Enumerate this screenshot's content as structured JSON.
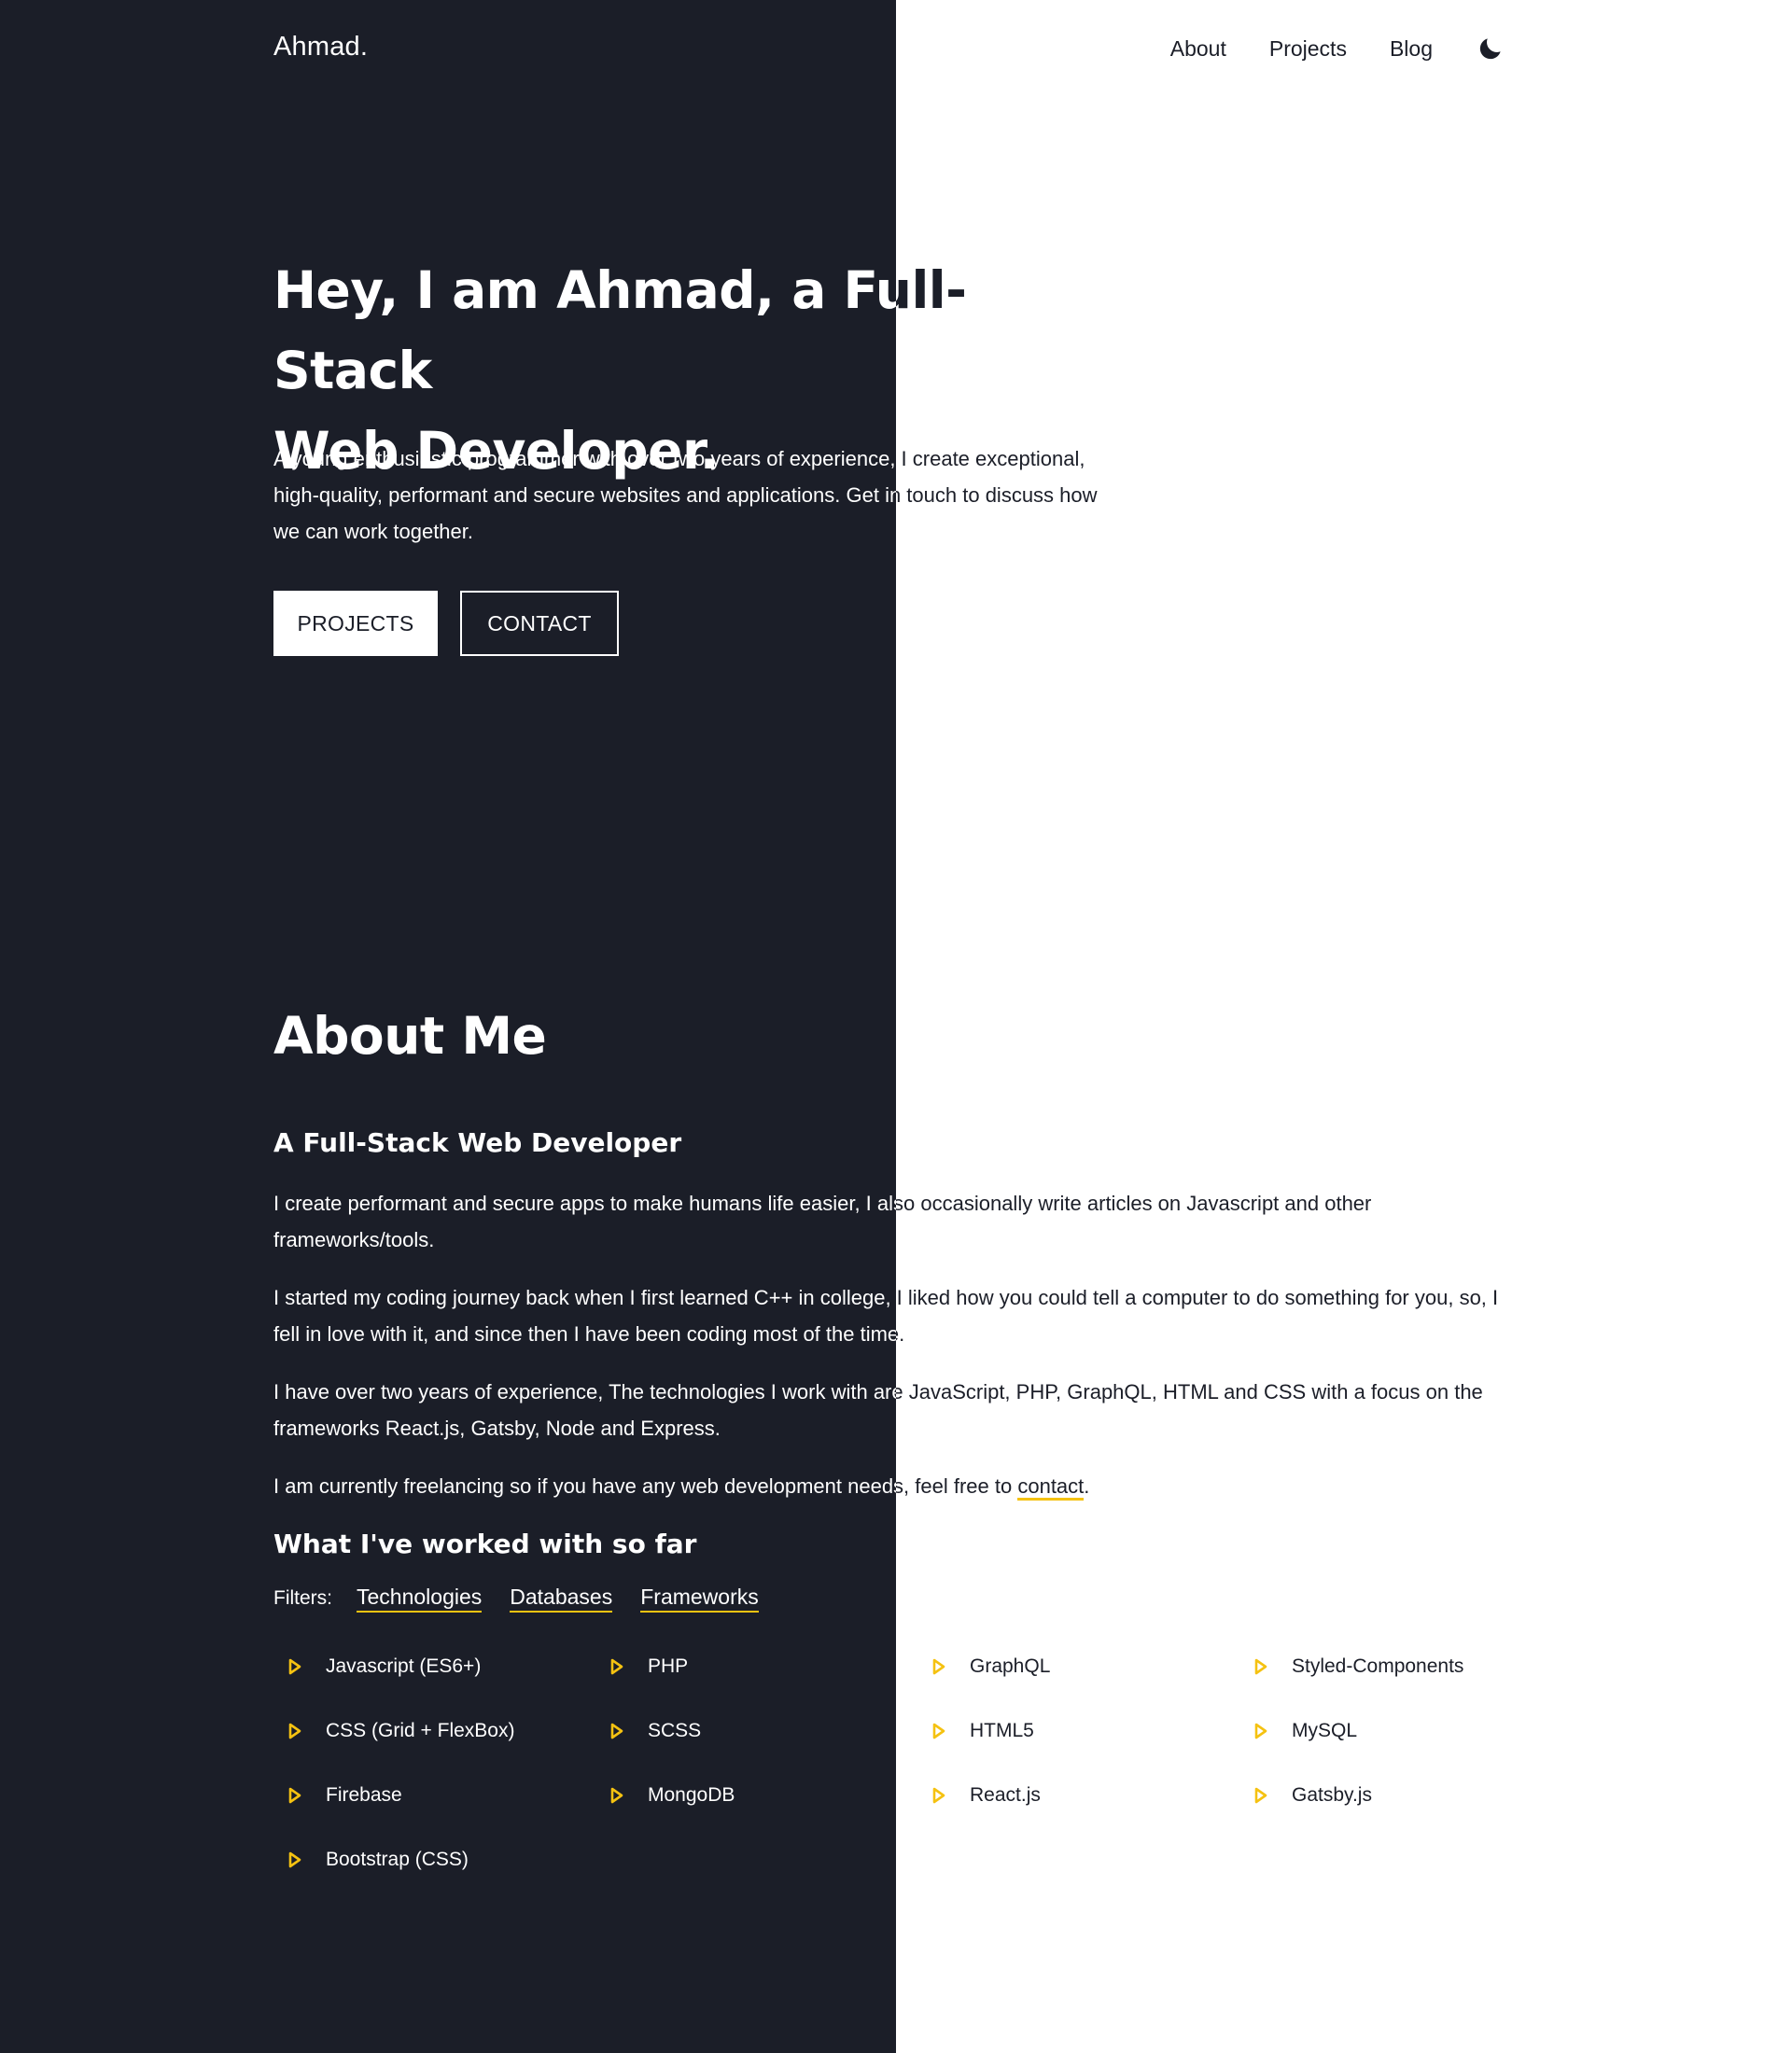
{
  "colors": {
    "dark": "#1b1e28",
    "light": "#ffffff",
    "accent": "#f5c211"
  },
  "header": {
    "logo": "Ahmad.",
    "nav": [
      "About",
      "Projects",
      "Blog"
    ],
    "theme_toggle_icon": "moon-icon"
  },
  "hero": {
    "title_line1": "Hey, I am Ahmad, a Full-Stack",
    "title_line2": "Web Developer.",
    "intro": "A young enthusiastic programmer with over two years of experience, I create exceptional, high-quality, performant and secure websites and applications. Get in touch to discuss how we can work together.",
    "buttons": [
      "PROJECTS",
      "CONTACT"
    ]
  },
  "about": {
    "title": "About Me",
    "subtitle": "A Full-Stack Web Developer",
    "p1": "I create performant and secure apps to make humans life easier, I also occasionally write articles on Javascript and other frameworks/tools.",
    "p2": "I started my coding journey back when I first learned C++ in college, I liked how you could tell a computer to do something for you, so, I fell in love with it, and since then I have been coding most of the time.",
    "p3": "I have over two years of experience, The technologies I work with are JavaScript, PHP, GraphQL, HTML and CSS with a focus on the frameworks React.js, Gatsby, Node and Express.",
    "p4_before": "I am currently freelancing so if you have any web development needs, feel free to ",
    "p4_link": "contact",
    "p4_after": "."
  },
  "worked": {
    "title": "What I've worked with so far",
    "filters_label": "Filters:",
    "filters": [
      "Technologies",
      "Databases",
      "Frameworks"
    ],
    "skill_icon": "triangle-bullet-icon",
    "skills": [
      "Javascript (ES6+)",
      "PHP",
      "GraphQL",
      "Styled-Components",
      "CSS (Grid + FlexBox)",
      "SCSS",
      "HTML5",
      "MySQL",
      "Firebase",
      "MongoDB",
      "React.js",
      "Gatsby.js",
      "Bootstrap (CSS)"
    ]
  }
}
